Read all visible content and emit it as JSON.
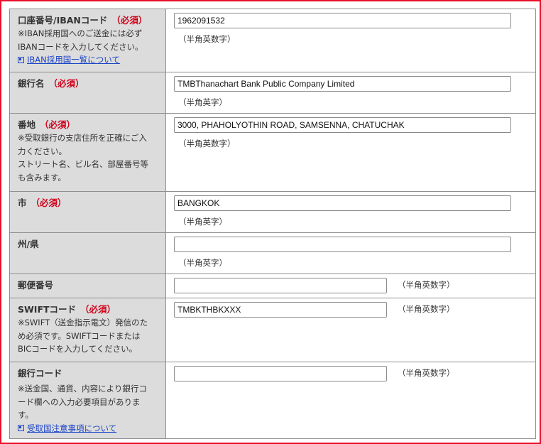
{
  "required_mark": "（必須）",
  "fields": {
    "account": {
      "label": "口座番号/IBANコード",
      "note": [
        "※IBAN採用国へのご送金には必ず",
        "IBANコードを入力してください。"
      ],
      "link": "IBAN採用国一覧について",
      "value": "1962091532",
      "hint": "（半角英数字）"
    },
    "bank_name": {
      "label": "銀行名",
      "value": "TMBThanachart Bank Public Company Limited",
      "hint": "（半角英字）"
    },
    "address": {
      "label": "番地",
      "note": [
        "※受取銀行の支店住所を正確にご入",
        "力ください。",
        "ストリート名、ビル名、部屋番号等",
        "も含みます。"
      ],
      "value": "3000, PHAHOLYOTHIN ROAD, SAMSENNA, CHATUCHAK",
      "hint": "（半角英数字）"
    },
    "city": {
      "label": "市",
      "value": "BANGKOK",
      "hint": "（半角英字）"
    },
    "state": {
      "label": "州/県",
      "value": "",
      "hint": "（半角英字）"
    },
    "postal": {
      "label": "郵便番号",
      "value": "",
      "hint": "（半角英数字）"
    },
    "swift": {
      "label": "SWIFTコード",
      "note": [
        "※SWIFT（送金指示電文）発信のた",
        "め必須です。SWIFTコードまたは",
        "BICコードを入力してください。"
      ],
      "value": "TMBKTHBKXXX",
      "hint": "（半角英数字）"
    },
    "bank_code": {
      "label": "銀行コード",
      "note": [
        "※送金国、通貨、内容により銀行コ",
        "ード欄への入力必要項目がありま",
        "す。"
      ],
      "link": "受取国注意事項について",
      "value": "",
      "hint": "（半角英数字）"
    }
  },
  "colors": {
    "frame_border": "#e8102a",
    "required": "#d0021b",
    "link": "#1a44c8",
    "label_bg": "#dcdcdc"
  }
}
